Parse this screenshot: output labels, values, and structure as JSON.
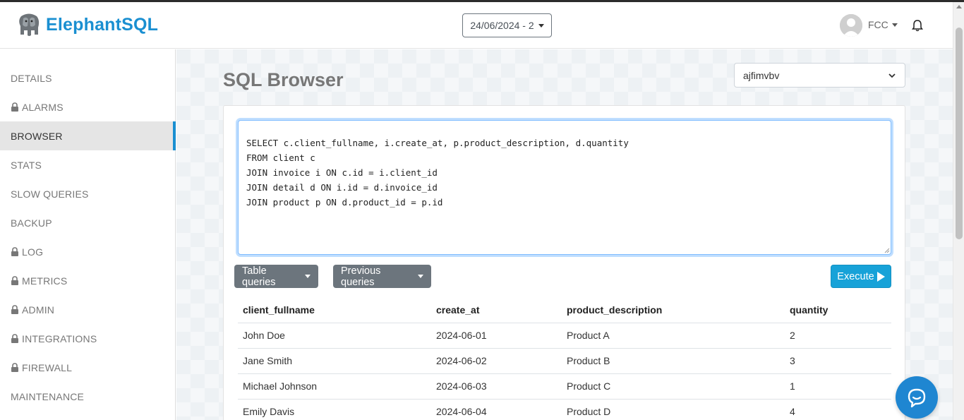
{
  "brand": {
    "name": "ElephantSQL"
  },
  "header": {
    "instance_selector": "24/06/2024 - 2",
    "user": "FCC"
  },
  "sidebar": {
    "items": [
      {
        "label": "DETAILS",
        "locked": false,
        "active": false
      },
      {
        "label": "ALARMS",
        "locked": true,
        "active": false
      },
      {
        "label": "BROWSER",
        "locked": false,
        "active": true
      },
      {
        "label": "STATS",
        "locked": false,
        "active": false
      },
      {
        "label": "SLOW QUERIES",
        "locked": false,
        "active": false
      },
      {
        "label": "BACKUP",
        "locked": false,
        "active": false
      },
      {
        "label": "LOG",
        "locked": true,
        "active": false
      },
      {
        "label": "METRICS",
        "locked": true,
        "active": false
      },
      {
        "label": "ADMIN",
        "locked": true,
        "active": false
      },
      {
        "label": "INTEGRATIONS",
        "locked": true,
        "active": false
      },
      {
        "label": "FIREWALL",
        "locked": true,
        "active": false
      },
      {
        "label": "MAINTENANCE",
        "locked": false,
        "active": false
      }
    ]
  },
  "main": {
    "title": "SQL Browser",
    "database_select": "ajfimvbv",
    "query": "SELECT c.client_fullname, i.create_at, p.product_description, d.quantity\nFROM client c\nJOIN invoice i ON c.id = i.client_id\nJOIN detail d ON i.id = d.invoice_id\nJOIN product p ON d.product_id = p.id",
    "buttons": {
      "table_queries": "Table queries",
      "previous_queries": "Previous queries",
      "execute": "Execute"
    },
    "results": {
      "columns": [
        "client_fullname",
        "create_at",
        "product_description",
        "quantity"
      ],
      "rows": [
        [
          "John Doe",
          "2024-06-01",
          "Product A",
          "2"
        ],
        [
          "Jane Smith",
          "2024-06-02",
          "Product B",
          "3"
        ],
        [
          "Michael Johnson",
          "2024-06-03",
          "Product C",
          "1"
        ],
        [
          "Emily Davis",
          "2024-06-04",
          "Product D",
          "4"
        ]
      ]
    }
  },
  "colors": {
    "brand": "#1a8fd1",
    "active_indicator": "#1a8fd1",
    "execute": "#17a2d8",
    "secondary_button": "#6c757d",
    "help_bubble": "#1f86d1"
  },
  "icons": {
    "logo": "elephant-logo-icon",
    "lock": "lock-icon",
    "bell": "bell-icon",
    "avatar": "user-avatar-icon",
    "help": "chat-bubble-icon",
    "play": "play-icon"
  }
}
